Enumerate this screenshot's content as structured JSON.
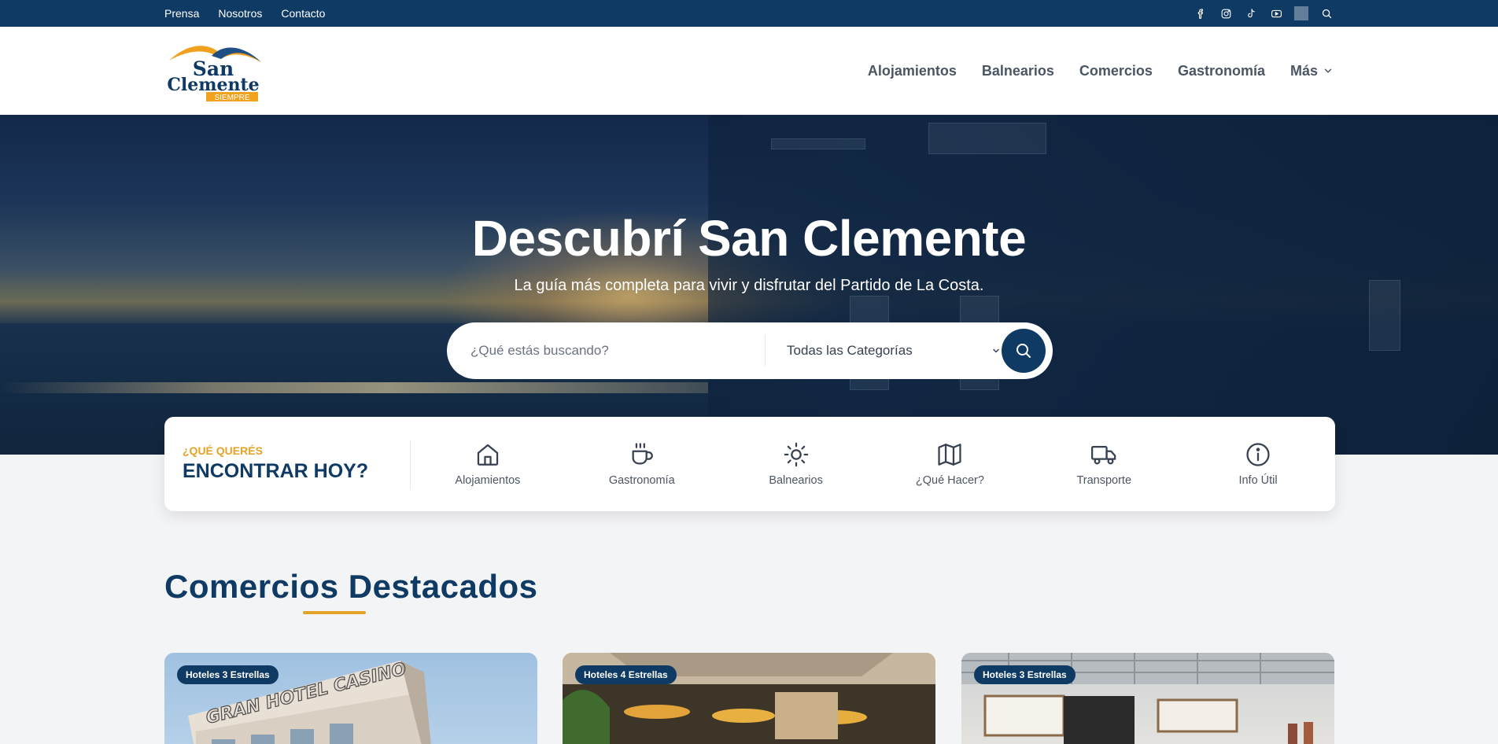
{
  "topbar": {
    "links": [
      "Prensa",
      "Nosotros",
      "Contacto"
    ],
    "social_icons": [
      "facebook-icon",
      "instagram-icon",
      "tiktok-icon",
      "youtube-icon"
    ],
    "search_icon": "search-icon"
  },
  "header": {
    "logo": {
      "line1": "San",
      "line2": "Clemente",
      "tag": "SIEMPRE"
    },
    "nav": [
      "Alojamientos",
      "Balnearios",
      "Comercios",
      "Gastronomía",
      "Más"
    ]
  },
  "hero": {
    "title": "Descubrí San Clemente",
    "subtitle": "La guía más completa para vivir y disfrutar del Partido de La Costa.",
    "search": {
      "placeholder": "¿Qué estás buscando?",
      "category_selected": "Todas las Categorías"
    }
  },
  "quick": {
    "eyebrow": "¿QUÉ QUERÉS",
    "heading": "ENCONTRAR HOY?",
    "items": [
      {
        "label": "Alojamientos",
        "icon": "home-icon"
      },
      {
        "label": "Gastronomía",
        "icon": "coffee-cup-icon"
      },
      {
        "label": "Balnearios",
        "icon": "sun-icon"
      },
      {
        "label": "¿Qué Hacer?",
        "icon": "map-icon"
      },
      {
        "label": "Transporte",
        "icon": "truck-icon"
      },
      {
        "label": "Info Útil",
        "icon": "info-icon"
      }
    ]
  },
  "featured": {
    "title": "Comercios Destacados",
    "cards": [
      {
        "badge": "Hoteles 3 Estrellas",
        "sign": "GRAN HOTEL CASINO"
      },
      {
        "badge": "Hoteles 4 Estrellas"
      },
      {
        "badge": "Hoteles 3 Estrellas"
      }
    ]
  },
  "colors": {
    "brand": "#0f3a63",
    "accent": "#e3a326"
  }
}
